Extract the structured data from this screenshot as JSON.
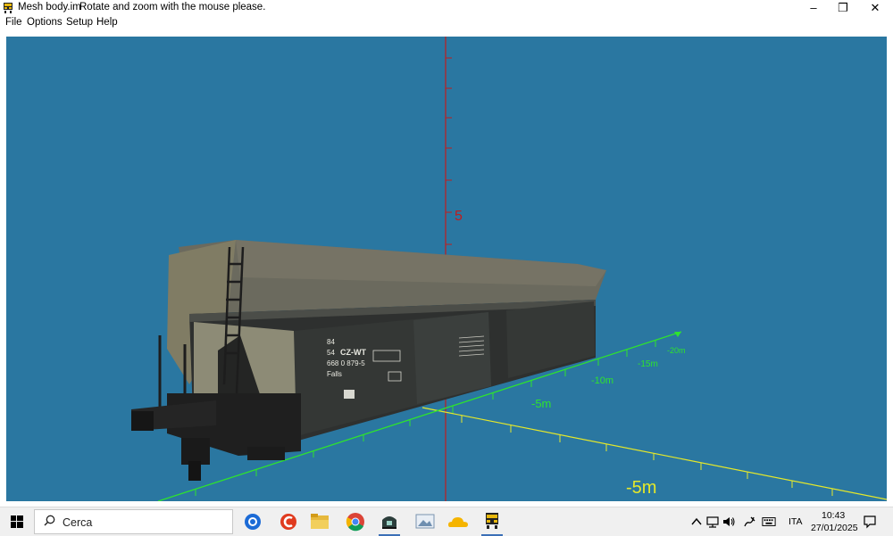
{
  "window": {
    "title": "Mesh body.im",
    "hint": "Rotate and zoom with the mouse please.",
    "controls": {
      "minimize": "–",
      "maximize": "❐",
      "close": "✕"
    }
  },
  "menu": {
    "items": [
      {
        "label": "File"
      },
      {
        "label": "Options"
      },
      {
        "label": "Setup"
      },
      {
        "label": "Help"
      }
    ]
  },
  "viewport": {
    "background": "#2a77a1",
    "axis_labels": {
      "vertical": "5",
      "scale_near": "-5m",
      "axis2_5": "-5m",
      "axis2_10": "-10m",
      "axis2_15": "-15m",
      "axis2_20": "-20m"
    },
    "wagon_markings": {
      "line1": "84",
      "line2": "54",
      "brand": "CZ-WT",
      "number": "668 0 879-5",
      "type": "Falls"
    },
    "colors": {
      "axis_green": "#2ee32e",
      "axis_yellow": "#e5e82a",
      "axis_red": "#c01d1d"
    }
  },
  "taskbar": {
    "search_placeholder": "Cerca",
    "apps": [
      {
        "icon": "cortana-icon"
      },
      {
        "icon": "ccleaner-icon"
      },
      {
        "icon": "file-explorer-icon"
      },
      {
        "icon": "chrome-icon"
      },
      {
        "icon": "railworks-icon"
      },
      {
        "icon": "photos-icon"
      },
      {
        "icon": "onedrive-icon"
      },
      {
        "icon": "train-app-icon"
      }
    ],
    "tray": {
      "language": "ITA",
      "time": "10:43",
      "date": "27/01/2025"
    }
  }
}
